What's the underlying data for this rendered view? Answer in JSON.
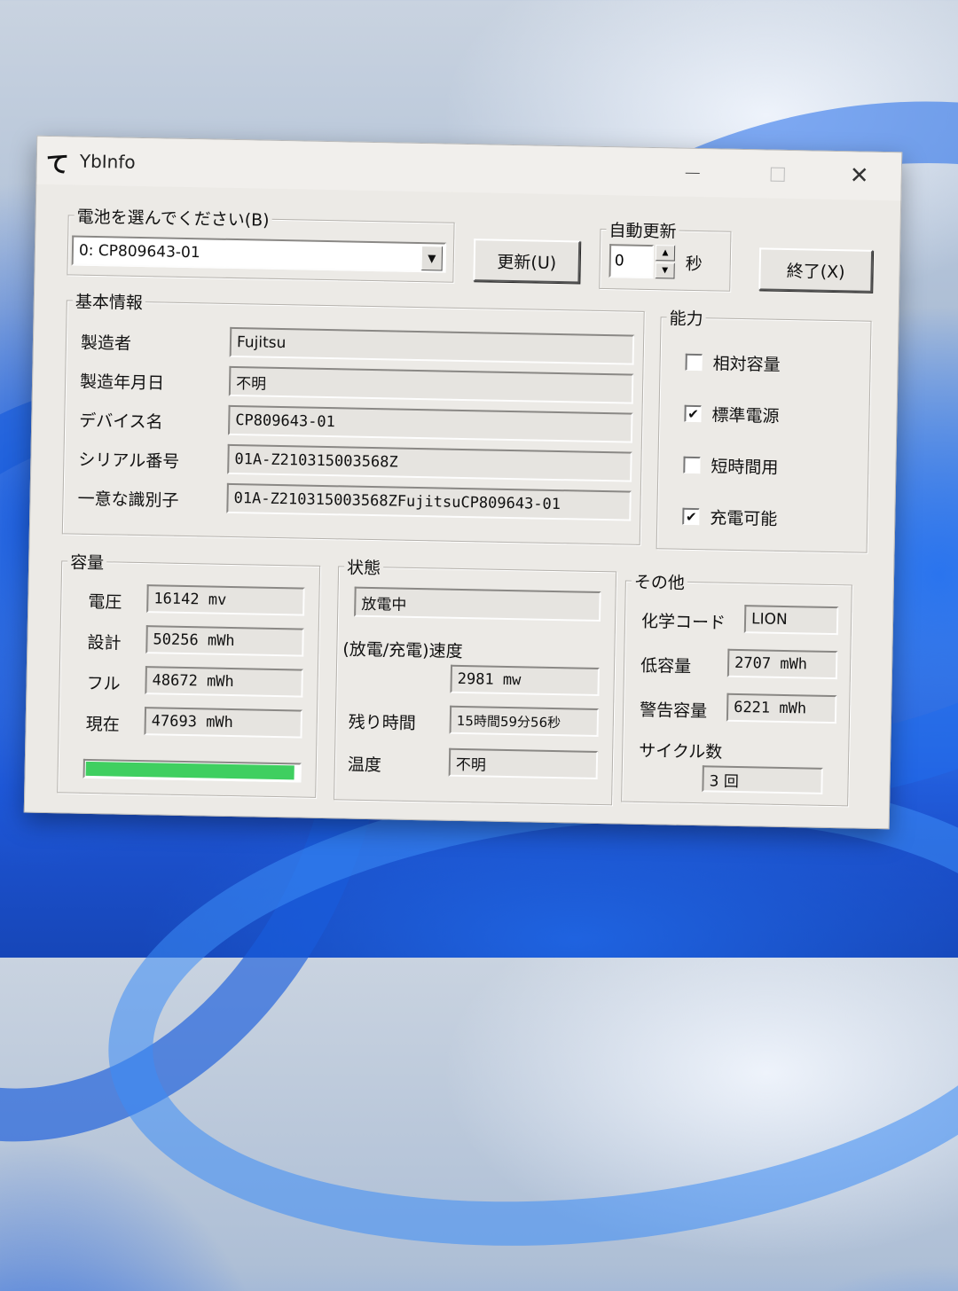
{
  "window": {
    "title": "YbInfo",
    "icon": "app-logo-icon"
  },
  "battery_select": {
    "label": "電池を選んでください(B)",
    "value": "0: CP809643-01"
  },
  "refresh_button": "更新(U)",
  "auto_refresh": {
    "label": "自動更新",
    "value": "0",
    "unit": "秒"
  },
  "exit_button": "終了(X)",
  "basic_info": {
    "label": "基本情報",
    "rows": [
      {
        "label": "製造者",
        "value": "Fujitsu"
      },
      {
        "label": "製造年月日",
        "value": "不明"
      },
      {
        "label": "デバイス名",
        "value": "CP809643-01"
      },
      {
        "label": "シリアル番号",
        "value": "01A-Z210315003568Z"
      },
      {
        "label": "一意な識別子",
        "value": "01A-Z210315003568ZFujitsuCP809643-01"
      }
    ]
  },
  "capabilities": {
    "label": "能力",
    "items": [
      {
        "label": "相対容量",
        "checked": false,
        "mark": ""
      },
      {
        "label": "標準電源",
        "checked": true,
        "mark": "✔"
      },
      {
        "label": "短時間用",
        "checked": false,
        "mark": ""
      },
      {
        "label": "充電可能",
        "checked": true,
        "mark": "✔"
      }
    ]
  },
  "capacity": {
    "label": "容量",
    "rows": [
      {
        "label": "電圧",
        "value": "16142 mv"
      },
      {
        "label": "設計",
        "value": "50256 mWh"
      },
      {
        "label": "フル",
        "value": "48672 mWh"
      },
      {
        "label": "現在",
        "value": "47693 mWh"
      }
    ],
    "charge_fraction": 0.98,
    "bar_color": "#3fcf60"
  },
  "status": {
    "label": "状態",
    "state": "放電中",
    "rate_label": "(放電/充電)速度",
    "rate_value": "2981 mw",
    "remaining_label": "残り時間",
    "remaining_value": "15時間59分56秒",
    "temp_label": "温度",
    "temp_value": "不明"
  },
  "other": {
    "label": "その他",
    "chem_label": "化学コード",
    "chem_value": "LION",
    "low_label": "低容量",
    "low_value": "2707 mWh",
    "warn_label": "警告容量",
    "warn_value": "6221 mWh",
    "cycle_label": "サイクル数",
    "cycle_value": "3 回"
  }
}
